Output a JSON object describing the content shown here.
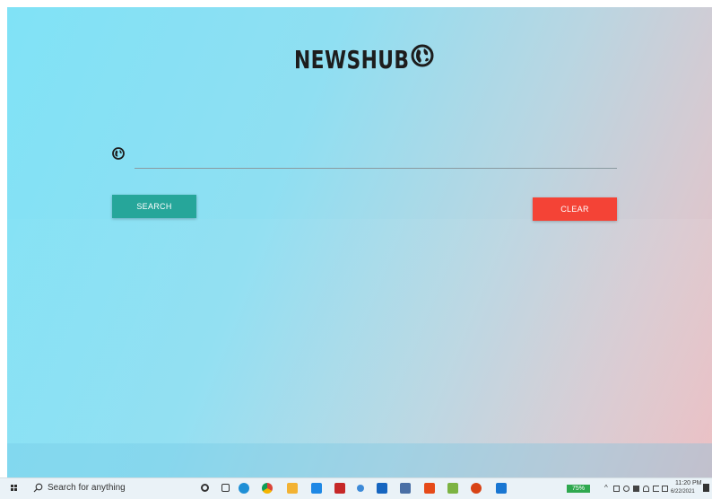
{
  "app": {
    "title": "NEWSHUB",
    "search": {
      "value": "",
      "placeholder": ""
    },
    "search_button": "SEARCH",
    "clear_button": "CLEAR"
  },
  "colors": {
    "search_button": "#26a69a",
    "clear_button": "#f44336",
    "background_start": "#80e2f6",
    "background_end": "#eabcc0"
  },
  "taskbar": {
    "search_text": "Search for anything",
    "battery": "75%",
    "time": "11:20 PM",
    "date": "6/22/2021",
    "pinned_icons": [
      "cortana-icon",
      "task-view-icon",
      "edge-icon",
      "chrome-icon",
      "file-explorer-icon",
      "store-icon",
      "mcafee-icon",
      "app-icon",
      "mail-icon",
      "app-icon",
      "office-icon",
      "app-icon",
      "app-icon",
      "photos-icon"
    ]
  }
}
